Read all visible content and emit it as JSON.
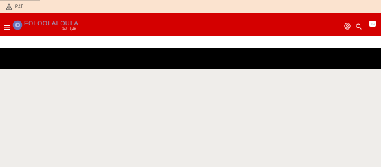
{
  "warning": {
    "text": "P2T"
  },
  "header": {
    "logo_name": "FOLOOLALOULA",
    "logo_subtitle": "فلول العلا",
    "lang_label": "EN"
  },
  "colors": {
    "header_bg": "#d40000",
    "warning_bg": "#fbe3cf",
    "banner_bg": "#000000",
    "page_bg": "#efedea"
  },
  "icons": {
    "warning": "warning-triangle-icon",
    "menu": "hamburger-menu-icon",
    "profile": "user-profile-icon",
    "search": "search-icon"
  }
}
